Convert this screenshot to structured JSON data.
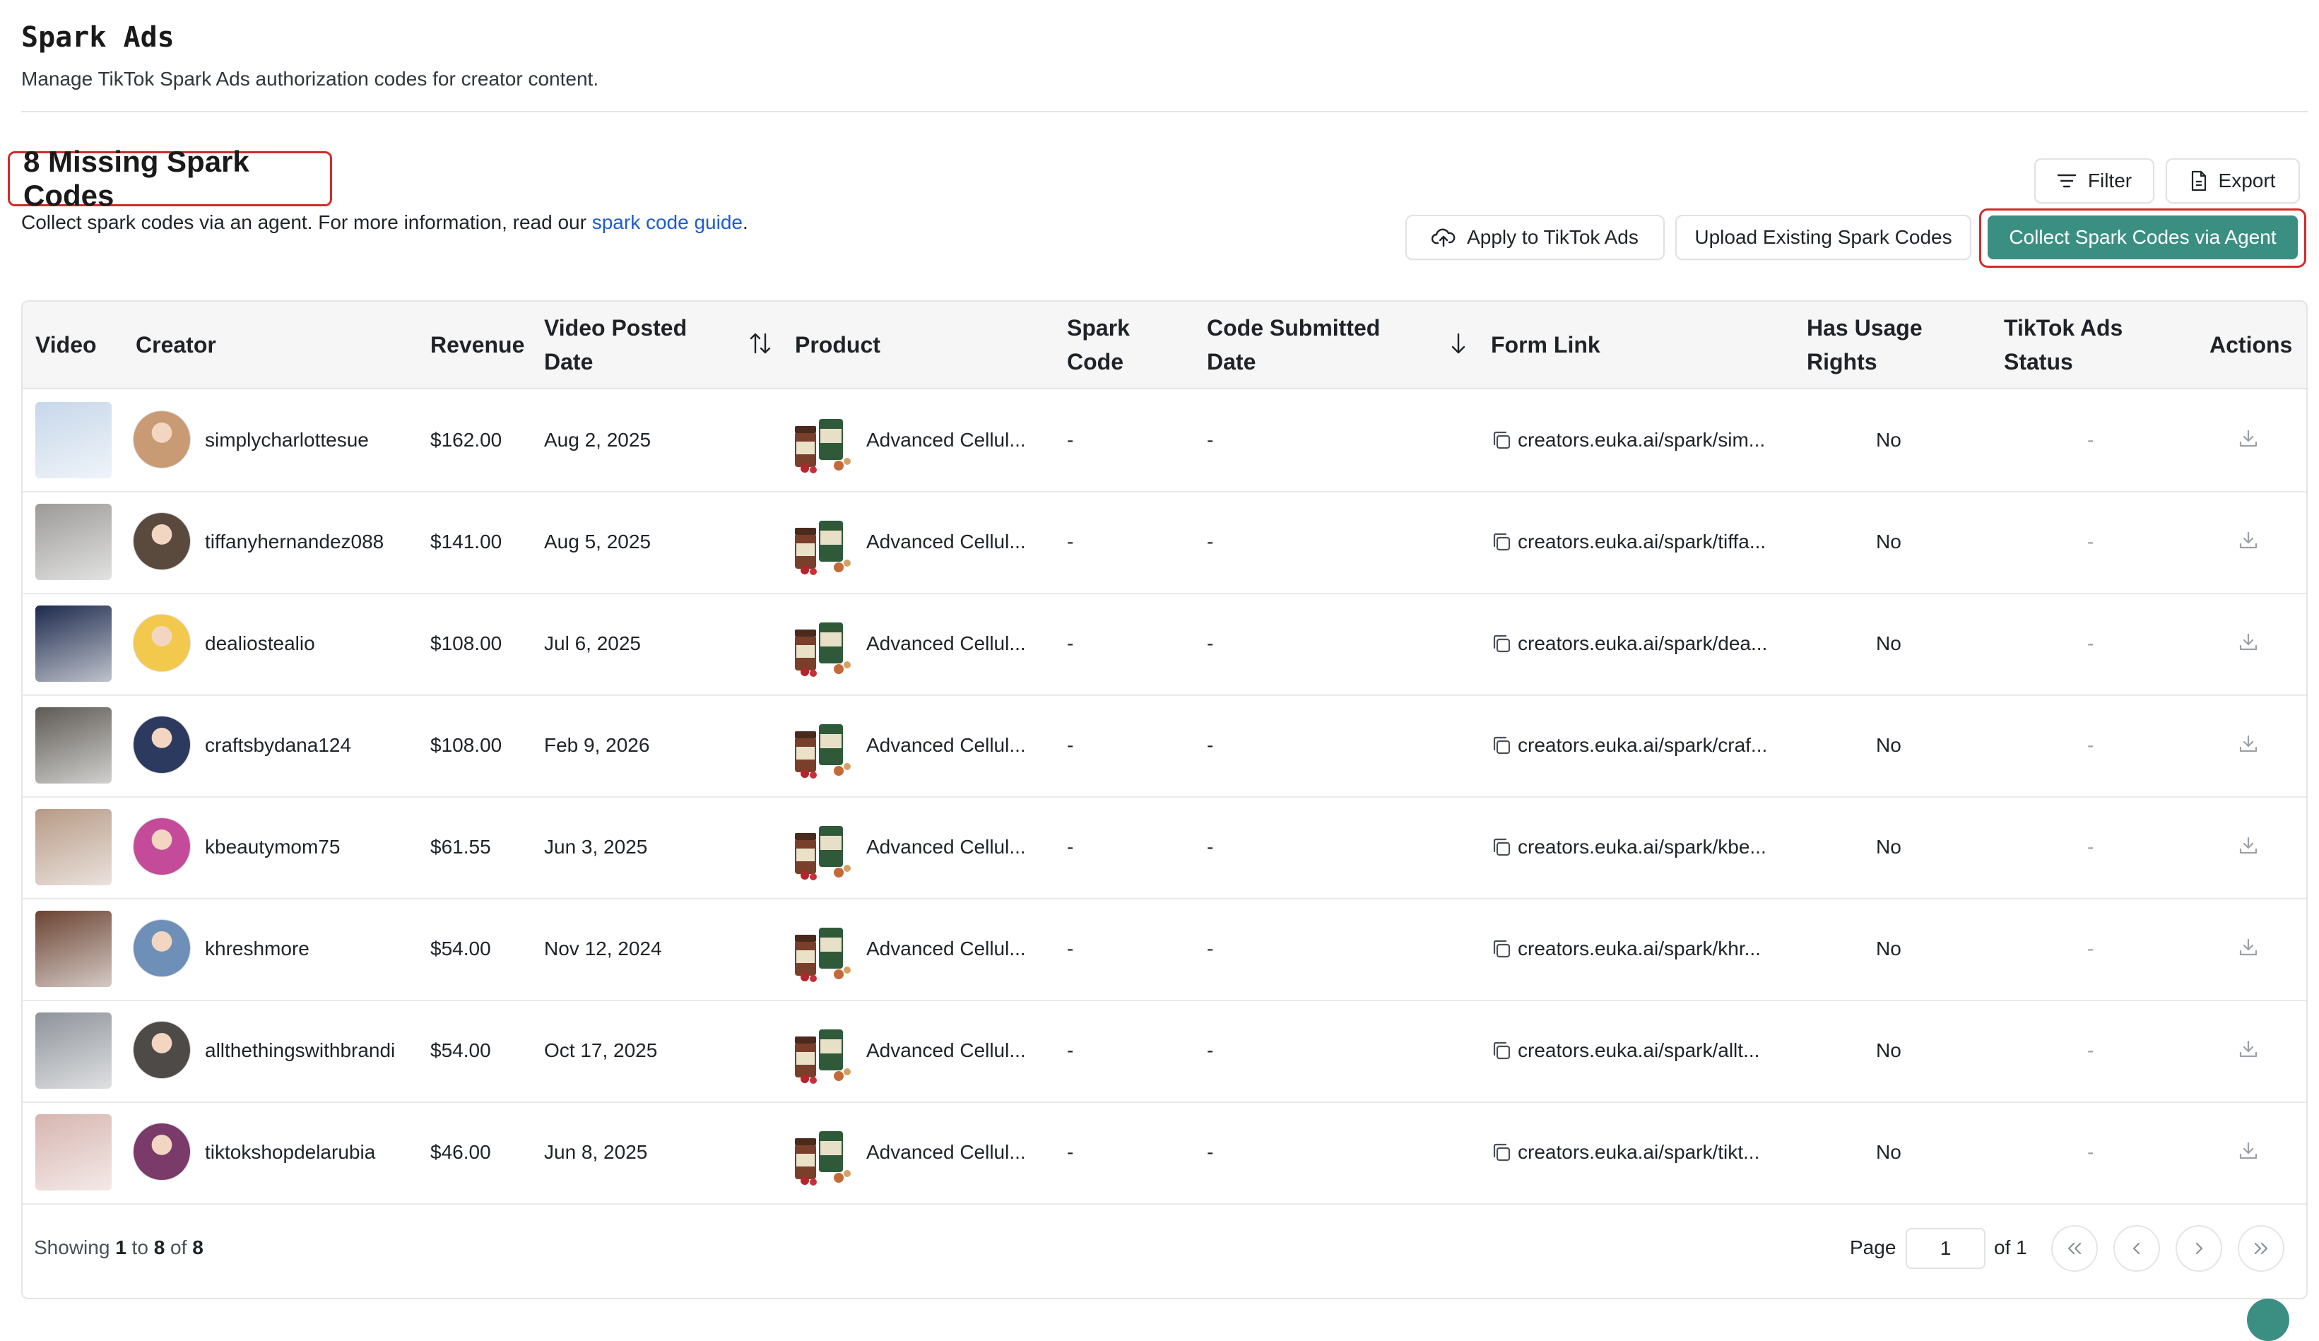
{
  "header": {
    "title": "Spark Ads",
    "subtitle": "Manage TikTok Spark Ads authorization codes for creator content."
  },
  "section": {
    "title": "8 Missing Spark Codes",
    "desc_prefix": "Collect spark codes via an agent. For more information, read our ",
    "desc_link": "spark code guide",
    "desc_suffix": "."
  },
  "toolbar": {
    "filter": "Filter",
    "export": "Export",
    "apply": "Apply to TikTok Ads",
    "upload": "Upload Existing Spark Codes",
    "collect": "Collect Spark Codes via Agent"
  },
  "columns": {
    "video": "Video",
    "creator": "Creator",
    "revenue": "Revenue",
    "posted_1": "Video Posted",
    "posted_2": "Date",
    "product": "Product",
    "spark_1": "Spark",
    "spark_2": "Code",
    "submitted_1": "Code Submitted",
    "submitted_2": "Date",
    "form_link": "Form Link",
    "usage_1": "Has Usage",
    "usage_2": "Rights",
    "status_1": "TikTok Ads",
    "status_2": "Status",
    "actions": "Actions"
  },
  "rows": [
    {
      "creator": "simplycharlottesue",
      "revenue": "$162.00",
      "posted": "Aug 2, 2025",
      "product": "Advanced Cellul...",
      "spark": "-",
      "submitted": "-",
      "link": "creators.euka.ai/spark/sim...",
      "usage": "No",
      "status": "-",
      "thumb_color": "#c7d7ea",
      "avatar_color": "#c89b75"
    },
    {
      "creator": "tiffanyhernandez088",
      "revenue": "$141.00",
      "posted": "Aug 5, 2025",
      "product": "Advanced Cellul...",
      "spark": "-",
      "submitted": "-",
      "link": "creators.euka.ai/spark/tiffa...",
      "usage": "No",
      "status": "-",
      "thumb_color": "#9b9a98",
      "avatar_color": "#5a4a3e"
    },
    {
      "creator": "dealiostealio",
      "revenue": "$108.00",
      "posted": "Jul 6, 2025",
      "product": "Advanced Cellul...",
      "spark": "-",
      "submitted": "-",
      "link": "creators.euka.ai/spark/dea...",
      "usage": "No",
      "status": "-",
      "thumb_color": "#1d2a4d",
      "avatar_color": "#f2c94c"
    },
    {
      "creator": "craftsbydana124",
      "revenue": "$108.00",
      "posted": "Feb 9, 2026",
      "product": "Advanced Cellul...",
      "spark": "-",
      "submitted": "-",
      "link": "creators.euka.ai/spark/craf...",
      "usage": "No",
      "status": "-",
      "thumb_color": "#5e5a54",
      "avatar_color": "#2b3a5e"
    },
    {
      "creator": "kbeautymom75",
      "revenue": "$61.55",
      "posted": "Jun 3, 2025",
      "product": "Advanced Cellul...",
      "spark": "-",
      "submitted": "-",
      "link": "creators.euka.ai/spark/kbe...",
      "usage": "No",
      "status": "-",
      "thumb_color": "#b79a86",
      "avatar_color": "#c44b9a"
    },
    {
      "creator": "khreshmore",
      "revenue": "$54.00",
      "posted": "Nov 12, 2024",
      "product": "Advanced Cellul...",
      "spark": "-",
      "submitted": "-",
      "link": "creators.euka.ai/spark/khr...",
      "usage": "No",
      "status": "-",
      "thumb_color": "#6b4332",
      "avatar_color": "#6d8fb8"
    },
    {
      "creator": "allthethingswithbrandi",
      "revenue": "$54.00",
      "posted": "Oct 17, 2025",
      "product": "Advanced Cellul...",
      "spark": "-",
      "submitted": "-",
      "link": "creators.euka.ai/spark/allt...",
      "usage": "No",
      "status": "-",
      "thumb_color": "#8e939a",
      "avatar_color": "#4d4a47"
    },
    {
      "creator": "tiktokshopdelarubia",
      "revenue": "$46.00",
      "posted": "Jun 8, 2025",
      "product": "Advanced Cellul...",
      "spark": "-",
      "submitted": "-",
      "link": "creators.euka.ai/spark/tikt...",
      "usage": "No",
      "status": "-",
      "thumb_color": "#d7b5b0",
      "avatar_color": "#7a3b6b"
    }
  ],
  "footer": {
    "showing": "Showing",
    "from": "1",
    "to_word": "to",
    "to": "8",
    "of_word": "of",
    "total": "8",
    "page_label": "Page",
    "page_value": "1",
    "of_pages": "of 1"
  },
  "colors": {
    "accent": "#3b8f82",
    "highlight_outline": "#d42a2a",
    "link": "#1d5bd6"
  }
}
